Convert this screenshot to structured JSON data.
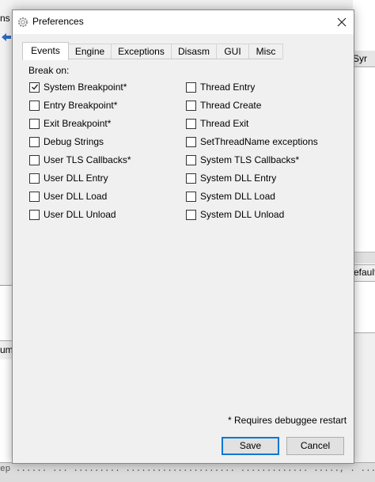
{
  "background": {
    "left_menu_fragment": "ns",
    "left_panel_fragment": "ump",
    "right_tab_fragment": "Syr",
    "right_button_fragment": "efault",
    "bottom_text_fragment": "ep ...... ...  ......... ..................... ............. ....., . .........., ..."
  },
  "dialog": {
    "title": "Preferences",
    "icon": "gear-icon",
    "close_icon": "close-icon"
  },
  "tabs": [
    {
      "label": "Events",
      "active": true
    },
    {
      "label": "Engine",
      "active": false
    },
    {
      "label": "Exceptions",
      "active": false
    },
    {
      "label": "Disasm",
      "active": false
    },
    {
      "label": "GUI",
      "active": false
    },
    {
      "label": "Misc",
      "active": false
    }
  ],
  "events": {
    "heading": "Break on:",
    "left": [
      {
        "label": "System Breakpoint*",
        "checked": true
      },
      {
        "label": "Entry Breakpoint*",
        "checked": false
      },
      {
        "label": "Exit Breakpoint*",
        "checked": false
      },
      {
        "label": "Debug Strings",
        "checked": false
      },
      {
        "label": "User TLS Callbacks*",
        "checked": false
      },
      {
        "label": "User DLL Entry",
        "checked": false
      },
      {
        "label": "User DLL Load",
        "checked": false
      },
      {
        "label": "User DLL Unload",
        "checked": false
      }
    ],
    "right": [
      {
        "label": "Thread Entry",
        "checked": false
      },
      {
        "label": "Thread Create",
        "checked": false
      },
      {
        "label": "Thread Exit",
        "checked": false
      },
      {
        "label": "SetThreadName exceptions",
        "checked": false
      },
      {
        "label": "System TLS Callbacks*",
        "checked": false
      },
      {
        "label": "System DLL Entry",
        "checked": false
      },
      {
        "label": "System DLL Load",
        "checked": false
      },
      {
        "label": "System DLL Unload",
        "checked": false
      }
    ]
  },
  "footer": {
    "note": "* Requires debuggee restart",
    "save_label": "Save",
    "cancel_label": "Cancel"
  },
  "colors": {
    "accent": "#0078d7",
    "dialog_bg": "#f0f0f0"
  }
}
